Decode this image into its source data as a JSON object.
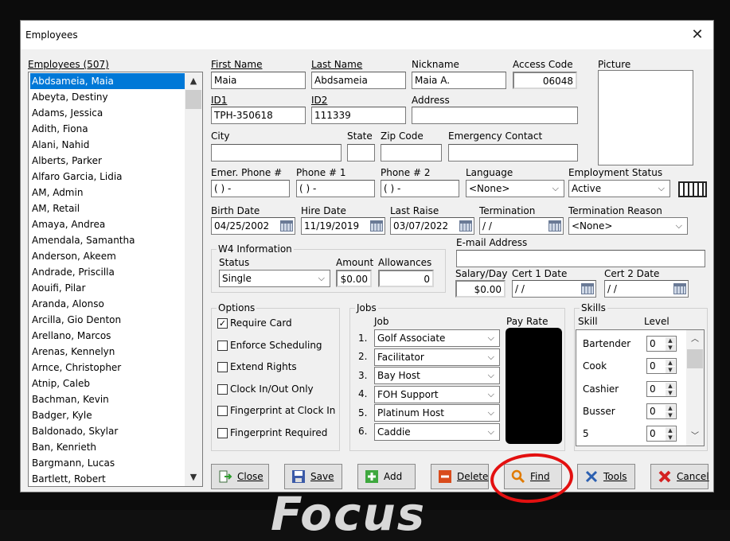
{
  "window": {
    "title": "Employees"
  },
  "background_text": "Focus",
  "list": {
    "header": "Employees (507)",
    "items": [
      "Abdsameia, Maia",
      "Abeyta, Destiny",
      "Adams, Jessica",
      "Adith, Fiona",
      "Alani, Nahid",
      "Alberts, Parker",
      "Alfaro Garcia, Lidia",
      "AM, Admin",
      "AM, Retail",
      "Amaya, Andrea",
      "Amendala, Samantha",
      "Anderson, Akeem",
      "Andrade, Priscilla",
      "Aouifi, Pilar",
      "Aranda, Alonso",
      "Arcilla, Gio Denton",
      "Arellano, Marcos",
      "Arenas, Kennelyn",
      "Arnce, Christopher",
      "Atnip, Caleb",
      "Bachman, Kevin",
      "Badger, Kyle",
      "Baldonado, Skylar",
      "Ban, Kenrieth",
      "Bargmann, Lucas",
      "Bartlett, Robert"
    ]
  },
  "form": {
    "first_name": {
      "label": "First Name",
      "value": "Maia"
    },
    "last_name": {
      "label": "Last Name",
      "value": "Abdsameia"
    },
    "nickname": {
      "label": "Nickname",
      "value": "Maia A."
    },
    "access_code": {
      "label": "Access Code",
      "value": "06048"
    },
    "picture": {
      "label": "Picture"
    },
    "id1": {
      "label": "ID1",
      "value": "TPH-350618"
    },
    "id2": {
      "label": "ID2",
      "value": "111339"
    },
    "address": {
      "label": "Address",
      "value": ""
    },
    "city": {
      "label": "City",
      "value": ""
    },
    "state": {
      "label": "State",
      "value": ""
    },
    "zip": {
      "label": "Zip Code",
      "value": ""
    },
    "emergency_contact": {
      "label": "Emergency Contact",
      "value": ""
    },
    "emer_phone": {
      "label": "Emer. Phone #",
      "value": "(  )   -"
    },
    "phone1": {
      "label": "Phone # 1",
      "value": "(  )   -"
    },
    "phone2": {
      "label": "Phone # 2",
      "value": "(  )   -"
    },
    "language": {
      "label": "Language",
      "value": "<None>"
    },
    "employment_status": {
      "label": "Employment Status",
      "value": "Active"
    },
    "birth_date": {
      "label": "Birth Date",
      "value": "04/25/2002"
    },
    "hire_date": {
      "label": "Hire Date",
      "value": "11/19/2019"
    },
    "last_raise": {
      "label": "Last Raise",
      "value": "03/07/2022"
    },
    "termination": {
      "label": "Termination",
      "value": " / /"
    },
    "termination_reason": {
      "label": "Termination Reason",
      "value": "<None>"
    },
    "email": {
      "label": "E-mail Address",
      "value": ""
    },
    "salary_day": {
      "label": "Salary/Day",
      "value": "$0.00"
    },
    "cert1": {
      "label": "Cert 1 Date",
      "value": " / /"
    },
    "cert2": {
      "label": "Cert 2 Date",
      "value": " / /"
    }
  },
  "w4": {
    "title": "W4 Information",
    "status_label": "Status",
    "status_value": "Single",
    "amount_label": "Amount",
    "amount_value": "$0.00",
    "allowances_label": "Allowances",
    "allowances_value": "0"
  },
  "options": {
    "title": "Options",
    "items": [
      {
        "label": "Require Card",
        "checked": true
      },
      {
        "label": "Enforce Scheduling",
        "checked": false
      },
      {
        "label": "Extend Rights",
        "checked": false
      },
      {
        "label": "Clock In/Out Only",
        "checked": false
      },
      {
        "label": "Fingerprint at Clock In",
        "checked": false
      },
      {
        "label": "Fingerprint Required",
        "checked": false
      }
    ]
  },
  "jobs": {
    "title": "Jobs",
    "job_header": "Job",
    "pay_header": "Pay Rate",
    "items": [
      {
        "num": "1.",
        "job": "Golf Associate"
      },
      {
        "num": "2.",
        "job": "Facilitator"
      },
      {
        "num": "3.",
        "job": "Bay Host"
      },
      {
        "num": "4.",
        "job": "FOH Support"
      },
      {
        "num": "5.",
        "job": "Platinum Host"
      },
      {
        "num": "6.",
        "job": "Caddie"
      }
    ]
  },
  "skills": {
    "title": "Skills",
    "skill_header": "Skill",
    "level_header": "Level",
    "items": [
      {
        "name": "Bartender",
        "level": "0"
      },
      {
        "name": "Cook",
        "level": "0"
      },
      {
        "name": "Cashier",
        "level": "0"
      },
      {
        "name": "Busser",
        "level": "0"
      },
      {
        "name": "5",
        "level": "0"
      }
    ]
  },
  "buttons": {
    "close": "Close",
    "save": "Save",
    "add": "Add",
    "delete": "Delete",
    "find": "Find",
    "tools": "Tools",
    "cancel": "Cancel"
  },
  "colors": {
    "selection": "#0078d7",
    "highlight_circle": "#e31010"
  }
}
